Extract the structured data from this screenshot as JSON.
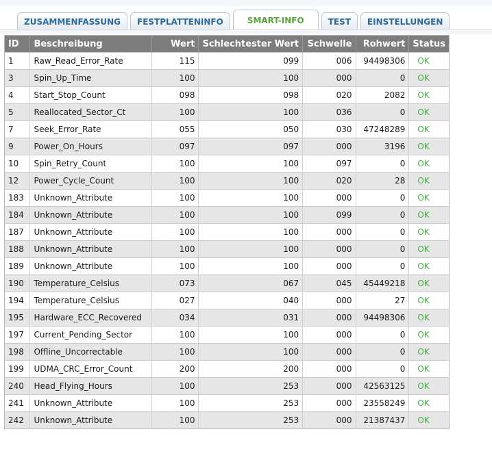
{
  "tabs": [
    {
      "label": "ZUSAMMENFASSUNG",
      "active": false
    },
    {
      "label": "FESTPLATTENINFO",
      "active": false
    },
    {
      "label": "SMART-INFO",
      "active": true
    },
    {
      "label": "TEST",
      "active": false
    },
    {
      "label": "EINSTELLUNGEN",
      "active": false
    }
  ],
  "colors": {
    "tab_text": "#2b6a9e",
    "tab_active_text": "#57a43a",
    "header_bg": "#7d7d7d",
    "status_ok": "#3fae3f"
  },
  "table": {
    "headers": {
      "id": "ID",
      "desc": "Beschreibung",
      "value": "Wert",
      "worst": "Schlechtester Wert",
      "threshold": "Schwelle",
      "raw": "Rohwert",
      "status": "Status"
    },
    "rows": [
      {
        "id": "1",
        "desc": "Raw_Read_Error_Rate",
        "value": "115",
        "worst": "099",
        "threshold": "006",
        "raw": "94498306",
        "status": "OK"
      },
      {
        "id": "3",
        "desc": "Spin_Up_Time",
        "value": "100",
        "worst": "100",
        "threshold": "000",
        "raw": "0",
        "status": "OK"
      },
      {
        "id": "4",
        "desc": "Start_Stop_Count",
        "value": "098",
        "worst": "098",
        "threshold": "020",
        "raw": "2082",
        "status": "OK"
      },
      {
        "id": "5",
        "desc": "Reallocated_Sector_Ct",
        "value": "100",
        "worst": "100",
        "threshold": "036",
        "raw": "0",
        "status": "OK"
      },
      {
        "id": "7",
        "desc": "Seek_Error_Rate",
        "value": "055",
        "worst": "050",
        "threshold": "030",
        "raw": "47248289",
        "status": "OK"
      },
      {
        "id": "9",
        "desc": "Power_On_Hours",
        "value": "097",
        "worst": "097",
        "threshold": "000",
        "raw": "3196",
        "status": "OK"
      },
      {
        "id": "10",
        "desc": "Spin_Retry_Count",
        "value": "100",
        "worst": "100",
        "threshold": "097",
        "raw": "0",
        "status": "OK"
      },
      {
        "id": "12",
        "desc": "Power_Cycle_Count",
        "value": "100",
        "worst": "100",
        "threshold": "020",
        "raw": "28",
        "status": "OK"
      },
      {
        "id": "183",
        "desc": "Unknown_Attribute",
        "value": "100",
        "worst": "100",
        "threshold": "000",
        "raw": "0",
        "status": "OK"
      },
      {
        "id": "184",
        "desc": "Unknown_Attribute",
        "value": "100",
        "worst": "100",
        "threshold": "099",
        "raw": "0",
        "status": "OK"
      },
      {
        "id": "187",
        "desc": "Unknown_Attribute",
        "value": "100",
        "worst": "100",
        "threshold": "000",
        "raw": "0",
        "status": "OK"
      },
      {
        "id": "188",
        "desc": "Unknown_Attribute",
        "value": "100",
        "worst": "100",
        "threshold": "000",
        "raw": "0",
        "status": "OK"
      },
      {
        "id": "189",
        "desc": "Unknown_Attribute",
        "value": "100",
        "worst": "100",
        "threshold": "000",
        "raw": "0",
        "status": "OK"
      },
      {
        "id": "190",
        "desc": "Temperature_Celsius",
        "value": "073",
        "worst": "067",
        "threshold": "045",
        "raw": "45449218",
        "status": "OK"
      },
      {
        "id": "194",
        "desc": "Temperature_Celsius",
        "value": "027",
        "worst": "040",
        "threshold": "000",
        "raw": "27",
        "status": "OK"
      },
      {
        "id": "195",
        "desc": "Hardware_ECC_Recovered",
        "value": "034",
        "worst": "031",
        "threshold": "000",
        "raw": "94498306",
        "status": "OK"
      },
      {
        "id": "197",
        "desc": "Current_Pending_Sector",
        "value": "100",
        "worst": "100",
        "threshold": "000",
        "raw": "0",
        "status": "OK"
      },
      {
        "id": "198",
        "desc": "Offline_Uncorrectable",
        "value": "100",
        "worst": "100",
        "threshold": "000",
        "raw": "0",
        "status": "OK"
      },
      {
        "id": "199",
        "desc": "UDMA_CRC_Error_Count",
        "value": "200",
        "worst": "200",
        "threshold": "000",
        "raw": "0",
        "status": "OK"
      },
      {
        "id": "240",
        "desc": "Head_Flying_Hours",
        "value": "100",
        "worst": "253",
        "threshold": "000",
        "raw": "42563125",
        "status": "OK"
      },
      {
        "id": "241",
        "desc": "Unknown_Attribute",
        "value": "100",
        "worst": "253",
        "threshold": "000",
        "raw": "23558249",
        "status": "OK"
      },
      {
        "id": "242",
        "desc": "Unknown_Attribute",
        "value": "100",
        "worst": "253",
        "threshold": "000",
        "raw": "21387437",
        "status": "OK"
      }
    ]
  }
}
